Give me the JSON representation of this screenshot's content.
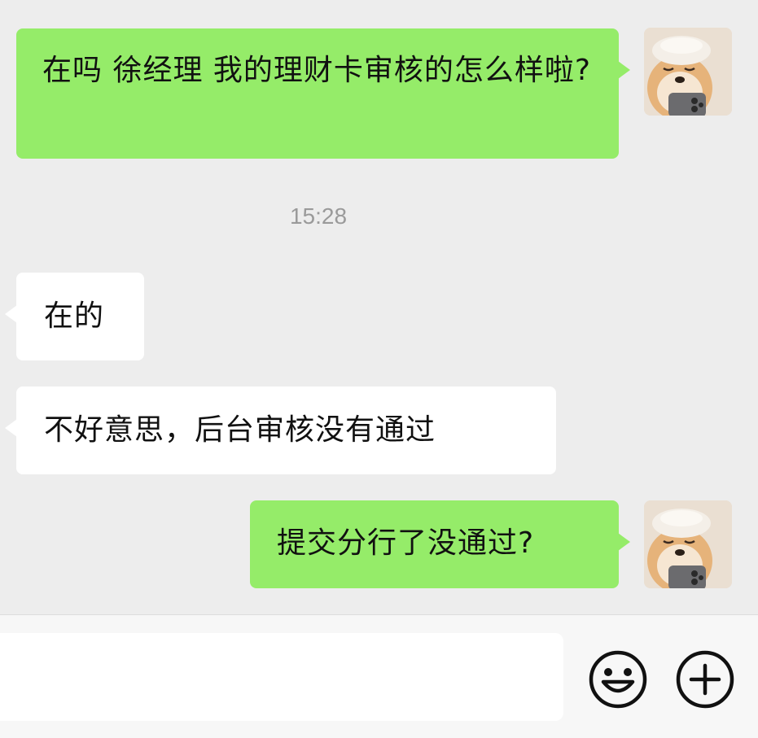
{
  "chat": {
    "messages": [
      {
        "direction": "out",
        "text": "在吗 徐经理 我的理财卡审核的怎么样啦?"
      },
      {
        "direction": "in",
        "text": "在的"
      },
      {
        "direction": "in",
        "text": "不好意思，后台审核没有通过"
      },
      {
        "direction": "out",
        "text": "提交分行了没通过?"
      }
    ],
    "timestamp": "15:28"
  },
  "input_bar": {
    "message_value": "",
    "emoji_icon": "smiley-face-icon",
    "more_icon": "plus-circle-icon"
  },
  "avatar": {
    "icon": "shiba-dog-avatar"
  },
  "colors": {
    "background": "#ededed",
    "outgoing_bubble": "#95ec69",
    "incoming_bubble": "#ffffff",
    "timestamp_text": "#9a9a9a"
  }
}
